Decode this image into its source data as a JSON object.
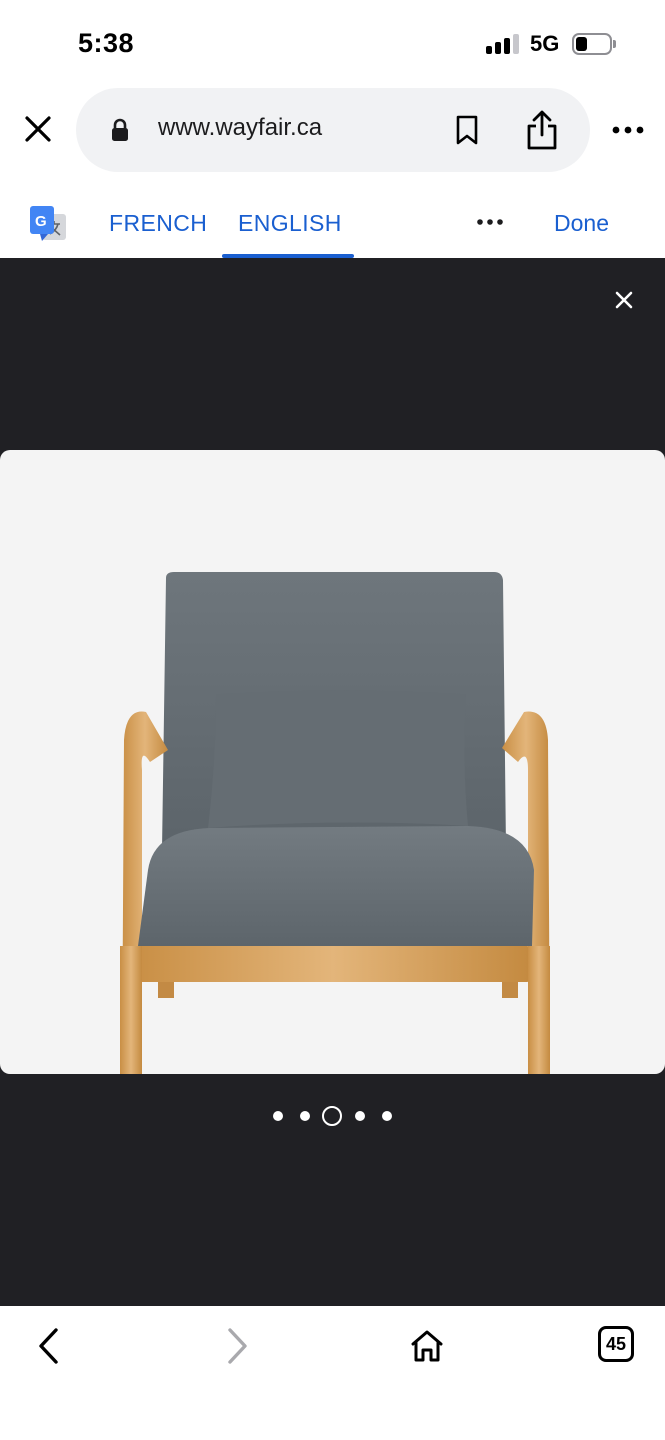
{
  "status_bar": {
    "time": "5:38",
    "network": "5G",
    "signal_bars_filled": 3,
    "battery_level": 0.25
  },
  "browser": {
    "close_tab_icon": "close-icon",
    "lock_icon": "lock-icon",
    "url": "www.wayfair.ca",
    "bookmark_icon": "bookmark-icon",
    "share_icon": "share-icon",
    "more_icon": "more-horizontal-icon"
  },
  "translate": {
    "logo_icon": "google-translate-icon",
    "tabs": [
      {
        "label": "FRENCH",
        "selected": false
      },
      {
        "label": "ENGLISH",
        "selected": true
      }
    ],
    "more_icon": "more-horizontal-icon",
    "done_label": "Done",
    "accent_color": "#1a5fd0"
  },
  "viewer": {
    "background_color": "#202024",
    "close_icon": "close-icon",
    "image_subject": "armchair",
    "pager": {
      "count": 5,
      "active_index": 2
    }
  },
  "bottom_toolbar": {
    "back_icon": "chevron-left-icon",
    "forward_icon": "chevron-right-icon",
    "forward_enabled": false,
    "home_icon": "home-icon",
    "tab_count": "45"
  }
}
